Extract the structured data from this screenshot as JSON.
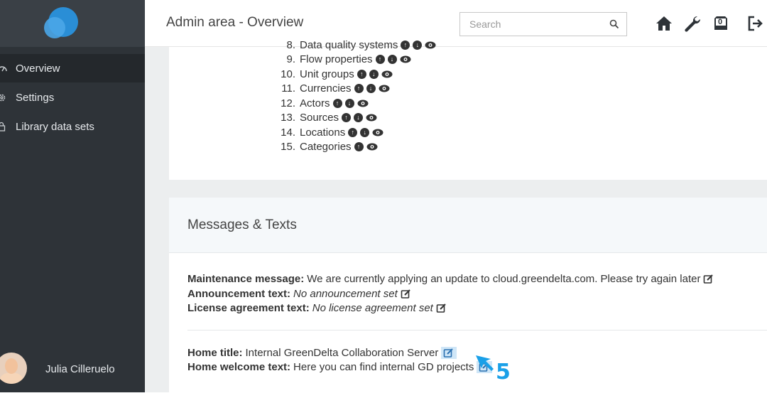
{
  "sidebar": {
    "items": [
      {
        "label": "Overview",
        "icon": "dashboard-icon",
        "active": true
      },
      {
        "label": "Settings",
        "icon": "gear-icon",
        "active": false
      },
      {
        "label": "Library data sets",
        "icon": "lock-icon",
        "active": false
      }
    ],
    "user": {
      "name": "Julia Cilleruelo"
    }
  },
  "header": {
    "title": "Admin area - Overview",
    "search_placeholder": "Search",
    "icons": [
      "home-icon",
      "wrench-icon",
      "inbox-icon",
      "logout-icon"
    ],
    "inbox_count": "0"
  },
  "types_list": [
    {
      "num": "8.",
      "label": "Data quality systems",
      "up": true,
      "down": true,
      "view": true
    },
    {
      "num": "9.",
      "label": "Flow properties",
      "up": true,
      "down": true,
      "view": true
    },
    {
      "num": "10.",
      "label": "Unit groups",
      "up": true,
      "down": true,
      "view": true
    },
    {
      "num": "11.",
      "label": "Currencies",
      "up": true,
      "down": true,
      "view": true
    },
    {
      "num": "12.",
      "label": "Actors",
      "up": true,
      "down": true,
      "view": true
    },
    {
      "num": "13.",
      "label": "Sources",
      "up": true,
      "down": true,
      "view": true
    },
    {
      "num": "14.",
      "label": "Locations",
      "up": true,
      "down": true,
      "view": true
    },
    {
      "num": "15.",
      "label": "Categories",
      "up": true,
      "down": false,
      "view": true
    }
  ],
  "messages": {
    "title": "Messages & Texts",
    "maintenance_label": "Maintenance message:",
    "maintenance_value": "We are currently applying an update to cloud.greendelta.com. Please try again later",
    "announcement_label": "Announcement text:",
    "announcement_value": "No announcement set",
    "license_label": "License agreement text:",
    "license_value": "No license agreement set",
    "home_title_label": "Home title:",
    "home_title_value": "Internal GreenDelta Collaboration Server",
    "home_welcome_label": "Home welcome text:",
    "home_welcome_value": "Here you can find internal GD projects"
  },
  "annotation": {
    "step": "5"
  },
  "colors": {
    "sidebar": "#2e3338",
    "accent": "#2a8ed6",
    "highlight": "#cfe6f7",
    "annotation": "#1aa0e8"
  }
}
